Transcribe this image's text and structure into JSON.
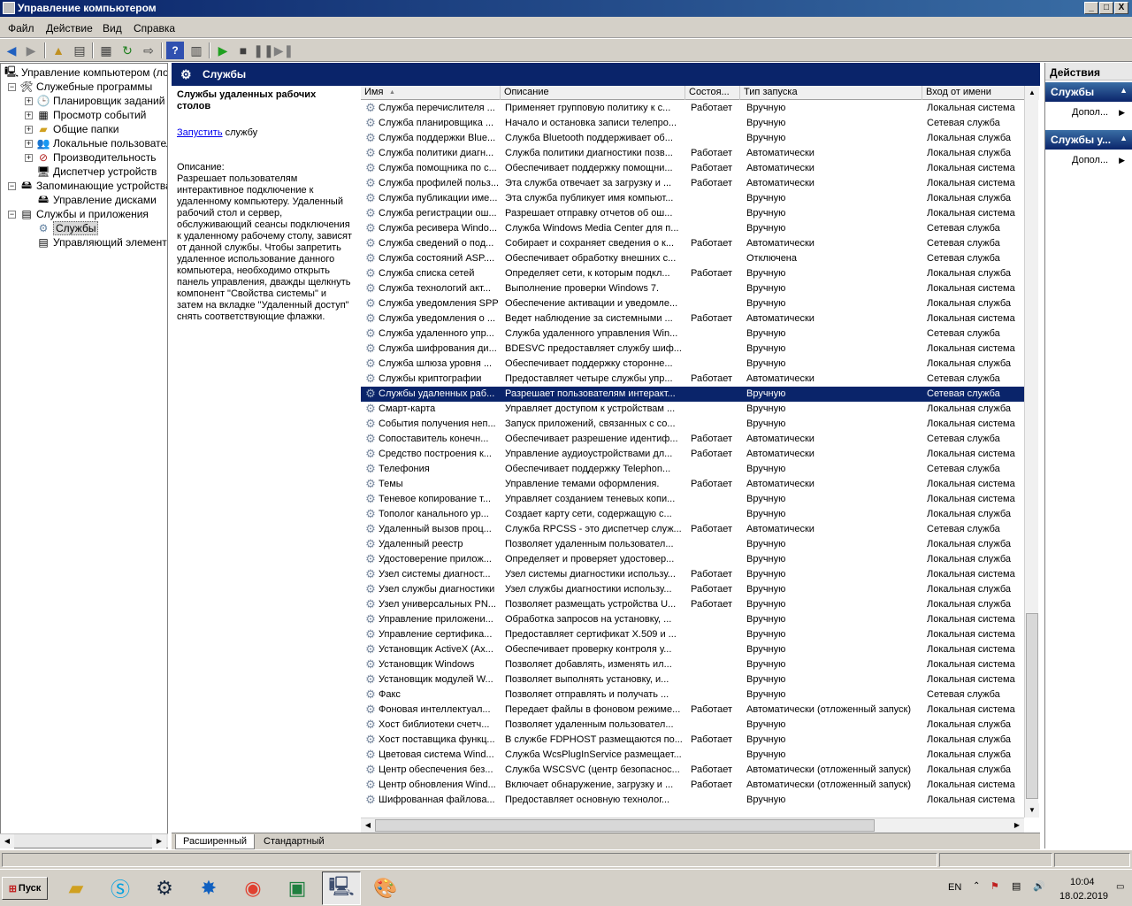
{
  "window": {
    "title": "Управление компьютером",
    "btn_min": "_",
    "btn_max": "□",
    "btn_close": "X"
  },
  "menu": [
    "Файл",
    "Действие",
    "Вид",
    "Справка"
  ],
  "tree": {
    "root": "Управление компьютером (лока",
    "items": [
      {
        "label": "Служебные программы"
      },
      {
        "label": "Планировщик заданий"
      },
      {
        "label": "Просмотр событий"
      },
      {
        "label": "Общие папки"
      },
      {
        "label": "Локальные пользовател"
      },
      {
        "label": "Производительность"
      },
      {
        "label": "Диспетчер устройств"
      },
      {
        "label": "Запоминающие устройства"
      },
      {
        "label": "Управление дисками"
      },
      {
        "label": "Службы и приложения"
      },
      {
        "label": "Службы"
      },
      {
        "label": "Управляющий элемент W"
      }
    ]
  },
  "center": {
    "header": "Службы",
    "desc_title": "Службы удаленных рабочих столов",
    "desc_start_link": "Запустить",
    "desc_start_rest": " службу",
    "desc_label": "Описание:",
    "desc_text": "Разрешает пользователям интерактивное подключение к удаленному компьютеру. Удаленный рабочий стол и сервер, обслуживающий сеансы подключения к удаленному рабочему столу, зависят от данной службы. Чтобы запретить удаленное использование данного компьютера, необходимо открыть панель управления, дважды щелкнуть компонент \"Свойства системы\" и затем на вкладке \"Удаленный доступ\" снять соответствующие флажки."
  },
  "columns": {
    "name": "Имя",
    "desc": "Описание",
    "status": "Состоя...",
    "startup": "Тип запуска",
    "logon": "Вход от имени"
  },
  "rows": [
    [
      "Служба перечислителя ...",
      "Применяет групповую политику к с...",
      "Работает",
      "Вручную",
      "Локальная система"
    ],
    [
      "Служба планировщика ...",
      "Начало и остановка записи телепро...",
      "",
      "Вручную",
      "Сетевая служба"
    ],
    [
      "Служба поддержки Blue...",
      "Служба Bluetooth поддерживает об...",
      "",
      "Вручную",
      "Локальная служба"
    ],
    [
      "Служба политики диагн...",
      "Служба политики диагностики позв...",
      "Работает",
      "Автоматически",
      "Локальная служба"
    ],
    [
      "Служба помощника по с...",
      "Обеспечивает поддержку помощни...",
      "Работает",
      "Автоматически",
      "Локальная система"
    ],
    [
      "Служба профилей польз...",
      "Эта служба отвечает за загрузку и ...",
      "Работает",
      "Автоматически",
      "Локальная система"
    ],
    [
      "Служба публикации име...",
      "Эта служба публикует имя компьют...",
      "",
      "Вручную",
      "Локальная служба"
    ],
    [
      "Служба регистрации ош...",
      "Разрешает отправку отчетов об ош...",
      "",
      "Вручную",
      "Локальная система"
    ],
    [
      "Служба ресивера Windo...",
      "Служба Windows Media Center для п...",
      "",
      "Вручную",
      "Сетевая служба"
    ],
    [
      "Служба сведений о под...",
      "Собирает и сохраняет сведения о к...",
      "Работает",
      "Автоматически",
      "Сетевая служба"
    ],
    [
      "Служба состояний ASP....",
      "Обеспечивает обработку внешних с...",
      "",
      "Отключена",
      "Сетевая служба"
    ],
    [
      "Служба списка сетей",
      "Определяет сети, к которым подкл...",
      "Работает",
      "Вручную",
      "Локальная служба"
    ],
    [
      "Служба технологий акт...",
      "Выполнение проверки Windows 7.",
      "",
      "Вручную",
      "Локальная система"
    ],
    [
      "Служба уведомления SPP",
      "Обеспечение активации и уведомле...",
      "",
      "Вручную",
      "Локальная служба"
    ],
    [
      "Служба уведомления о ...",
      "Ведет наблюдение за системными ...",
      "Работает",
      "Автоматически",
      "Локальная система"
    ],
    [
      "Служба удаленного упр...",
      "Служба удаленного управления Win...",
      "",
      "Вручную",
      "Сетевая служба"
    ],
    [
      "Служба шифрования ди...",
      "BDESVC предоставляет службу шиф...",
      "",
      "Вручную",
      "Локальная система"
    ],
    [
      "Служба шлюза уровня ...",
      "Обеспечивает поддержку сторонне...",
      "",
      "Вручную",
      "Локальная служба"
    ],
    [
      "Службы криптографии",
      "Предоставляет четыре службы упр...",
      "Работает",
      "Автоматически",
      "Сетевая служба"
    ],
    [
      "Службы удаленных раб...",
      "Разрешает пользователям интеракт...",
      "",
      "Вручную",
      "Сетевая служба"
    ],
    [
      "Смарт-карта",
      "Управляет доступом к устройствам ...",
      "",
      "Вручную",
      "Локальная служба"
    ],
    [
      "События получения неп...",
      "Запуск приложений, связанных с со...",
      "",
      "Вручную",
      "Локальная система"
    ],
    [
      "Сопоставитель конечн...",
      "Обеспечивает разрешение идентиф...",
      "Работает",
      "Автоматически",
      "Сетевая служба"
    ],
    [
      "Средство построения к...",
      "Управление аудиоустройствами дл...",
      "Работает",
      "Автоматически",
      "Локальная система"
    ],
    [
      "Телефония",
      "Обеспечивает поддержку Telephon...",
      "",
      "Вручную",
      "Сетевая служба"
    ],
    [
      "Темы",
      "Управление темами оформления.",
      "Работает",
      "Автоматически",
      "Локальная система"
    ],
    [
      "Теневое копирование т...",
      "Управляет созданием теневых копи...",
      "",
      "Вручную",
      "Локальная система"
    ],
    [
      "Тополог канального ур...",
      "Создает карту сети, содержащую с...",
      "",
      "Вручную",
      "Локальная служба"
    ],
    [
      "Удаленный вызов проц...",
      "Служба RPCSS - это диспетчер служ...",
      "Работает",
      "Автоматически",
      "Сетевая служба"
    ],
    [
      "Удаленный реестр",
      "Позволяет удаленным пользовател...",
      "",
      "Вручную",
      "Локальная служба"
    ],
    [
      "Удостоверение прилож...",
      "Определяет и проверяет удостовер...",
      "",
      "Вручную",
      "Локальная служба"
    ],
    [
      "Узел системы диагност...",
      "Узел системы диагностики использу...",
      "Работает",
      "Вручную",
      "Локальная система"
    ],
    [
      "Узел службы диагностики",
      "Узел службы диагностики использу...",
      "Работает",
      "Вручную",
      "Локальная служба"
    ],
    [
      "Узел универсальных PN...",
      "Позволяет размещать устройства U...",
      "Работает",
      "Вручную",
      "Локальная служба"
    ],
    [
      "Управление приложени...",
      "Обработка запросов на установку, ...",
      "",
      "Вручную",
      "Локальная система"
    ],
    [
      "Управление сертифика...",
      "Предоставляет сертификат X.509 и ...",
      "",
      "Вручную",
      "Локальная система"
    ],
    [
      "Установщик ActiveX (Ax...",
      "Обеспечивает проверку контроля у...",
      "",
      "Вручную",
      "Локальная система"
    ],
    [
      "Установщик Windows",
      "Позволяет добавлять, изменять ил...",
      "",
      "Вручную",
      "Локальная система"
    ],
    [
      "Установщик модулей W...",
      "Позволяет выполнять установку, и...",
      "",
      "Вручную",
      "Локальная система"
    ],
    [
      "Факс",
      "Позволяет отправлять и получать ...",
      "",
      "Вручную",
      "Сетевая служба"
    ],
    [
      "Фоновая интеллектуал...",
      "Передает файлы в фоновом режиме...",
      "Работает",
      "Автоматически (отложенный запуск)",
      "Локальная система"
    ],
    [
      "Хост библиотеки счетч...",
      "Позволяет удаленным пользовател...",
      "",
      "Вручную",
      "Локальная служба"
    ],
    [
      "Хост поставщика функц...",
      "В службе FDPHOST размещаются по...",
      "Работает",
      "Вручную",
      "Локальная служба"
    ],
    [
      "Цветовая система Wind...",
      "Служба WcsPlugInService размещает...",
      "",
      "Вручную",
      "Локальная служба"
    ],
    [
      "Центр обеспечения без...",
      "Служба WSCSVC (центр безопаснос...",
      "Работает",
      "Автоматически (отложенный запуск)",
      "Локальная служба"
    ],
    [
      "Центр обновления Wind...",
      "Включает обнаружение, загрузку и ...",
      "Работает",
      "Автоматически (отложенный запуск)",
      "Локальная система"
    ],
    [
      "Шифрованная файлова...",
      "Предоставляет основную технолог...",
      "",
      "Вручную",
      "Локальная система"
    ]
  ],
  "selected_row_index": 19,
  "tabs": [
    "Расширенный",
    "Стандартный"
  ],
  "actions": {
    "title": "Действия",
    "sec1": "Службы",
    "sec1_item": "Допол...",
    "sec2": "Службы у...",
    "sec2_item": "Допол..."
  },
  "taskbar": {
    "start": "Пуск",
    "lang": "EN",
    "time": "10:04",
    "date": "18.02.2019"
  },
  "colors": {
    "selection": "#0a246a",
    "header": "#0a246a"
  }
}
